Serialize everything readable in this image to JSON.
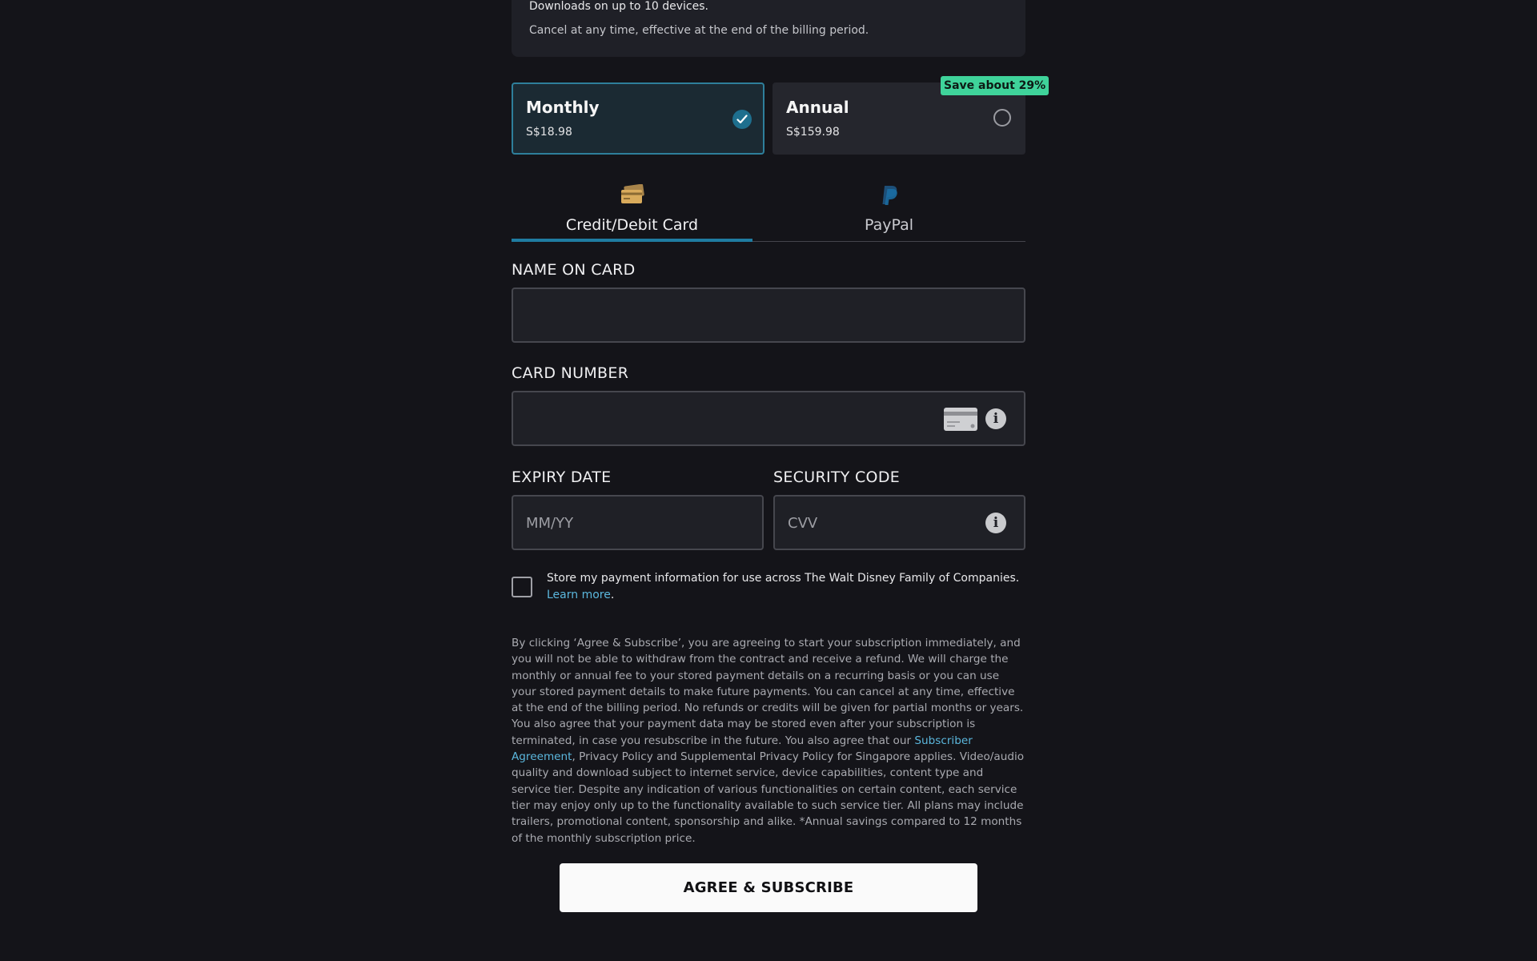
{
  "features": {
    "line1": "Downloads on up to 10 devices.",
    "line2": "Cancel at any time, effective at the end of the billing period."
  },
  "plans": {
    "monthly": {
      "name": "Monthly",
      "price": "S$18.98",
      "selected": true
    },
    "annual": {
      "name": "Annual",
      "price": "S$159.98",
      "selected": false,
      "badge": "Save about 29%"
    }
  },
  "payment_tabs": {
    "card": {
      "label": "Credit/Debit Card",
      "icon": "credit-card-icon",
      "active": true
    },
    "paypal": {
      "label": "PayPal",
      "icon": "paypal-icon",
      "active": false
    }
  },
  "form": {
    "name_label": "NAME ON CARD",
    "name_value": "",
    "card_number_label": "CARD NUMBER",
    "card_number_value": "",
    "expiry_label": "EXPIRY DATE",
    "expiry_placeholder": "MM/YY",
    "security_label": "SECURITY CODE",
    "security_placeholder": "CVV"
  },
  "store_payment": {
    "checked": false,
    "text": "Store my payment information for use across The Walt Disney Family of Companies.",
    "link": "Learn more",
    "suffix": "."
  },
  "legal": {
    "part1": "By clicking ‘Agree & Subscribe’, you are agreeing to start your subscription immediately, and you will not be able to withdraw from the contract and receive a refund. We will charge the monthly or annual fee to your stored payment details on a recurring basis or you can use your stored payment details to make future payments. You can cancel at any time, effective at the end of the billing period. No refunds or credits will be given for partial months or years. You also agree that your payment data may be stored even after your subscription is terminated, in case you resubscribe in the future. You also agree that our ",
    "link": "Subscriber Agreement",
    "part2": ", Privacy Policy and Supplemental Privacy Policy for Singapore applies. Video/audio quality and download subject to internet service, device capabilities, content type and service tier. Despite any indication of various functionalities on certain content, each service tier may enjoy only up to the functionality available to such service tier. All plans may include trailers, promotional content, sponsorship and alike. *Annual savings compared to 12 months of the monthly subscription price."
  },
  "agree_button": "AGREE & SUBSCRIBE",
  "colors": {
    "background": "#141419",
    "accent": "#1f7ca1",
    "badge": "#3fd39a",
    "link": "#5bb7dd"
  }
}
